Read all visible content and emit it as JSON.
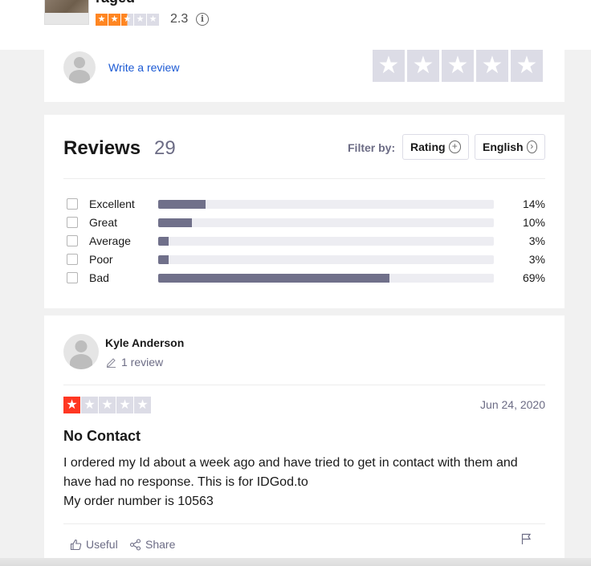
{
  "business": {
    "title_partial": "raged",
    "rating_score": "2.3",
    "rating_stars": 2.5,
    "info_icon": "info-icon"
  },
  "write_review": {
    "link_label": "Write a review",
    "star_glyph": "★"
  },
  "reviews": {
    "title": "Reviews",
    "count": "29",
    "filter_label": "Filter by:",
    "filter_rating_label": "Rating",
    "filter_language_label": "English",
    "distribution": [
      {
        "label": "Excellent",
        "percent": "14%",
        "fraction": 0.14
      },
      {
        "label": "Great",
        "percent": "10%",
        "fraction": 0.1
      },
      {
        "label": "Average",
        "percent": "3%",
        "fraction": 0.03
      },
      {
        "label": "Poor",
        "percent": "3%",
        "fraction": 0.03
      },
      {
        "label": "Bad",
        "percent": "69%",
        "fraction": 0.69
      }
    ]
  },
  "review": {
    "reviewer_name": "Kyle Anderson",
    "reviewer_review_count": "1 review",
    "rating": 1,
    "date": "Jun 24, 2020",
    "title": "No Contact",
    "body_line1": "I ordered my Id about a week ago and have tried to get in contact with them and have had no response. This is for IDGod.to",
    "body_line2": "My order number is 10563",
    "useful_label": "Useful",
    "share_label": "Share"
  },
  "colors": {
    "star_orange": "#ff8622",
    "star_red": "#ff3722",
    "star_empty": "#dcdce6",
    "bar_fill": "#70708a",
    "link_blue": "#1c5ad4"
  }
}
